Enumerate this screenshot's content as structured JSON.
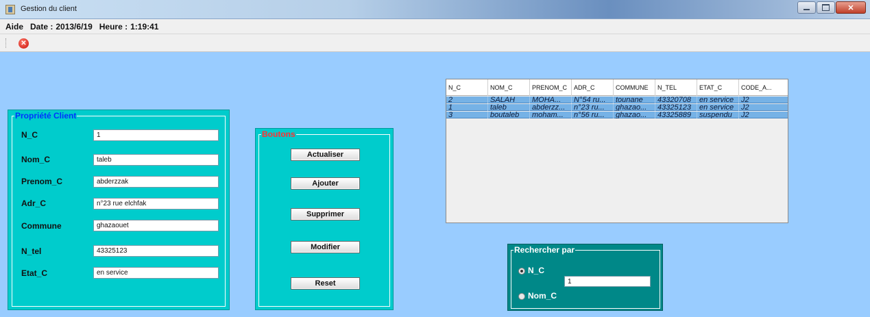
{
  "window": {
    "title": "Gestion du client",
    "icon": "app-icon"
  },
  "menu": {
    "help": "Aide",
    "date_label": "Date :",
    "date_value": "2013/6/19",
    "time_label": "Heure :",
    "time_value": "1:19:41"
  },
  "toolbar": {
    "close_icon": "close-circle-icon"
  },
  "client_form": {
    "legend": "Propriété Client",
    "fields": [
      {
        "label": "N_C",
        "value": "1"
      },
      {
        "label": "Nom_C",
        "value": "taleb"
      },
      {
        "label": "Prenom_C",
        "value": "abderzzak"
      },
      {
        "label": "Adr_C",
        "value": "n°23 rue elchfak"
      },
      {
        "label": "Commune",
        "value": "ghazaouet"
      },
      {
        "label": "N_tel",
        "value": "43325123"
      },
      {
        "label": "Etat_C",
        "value": "en service"
      }
    ]
  },
  "buttons_panel": {
    "legend": "Boutons",
    "buttons": [
      "Actualiser",
      "Ajouter",
      "Supprimer",
      "Modifier",
      "Reset"
    ]
  },
  "table": {
    "columns": [
      "N_C",
      "NOM_C",
      "PRENOM_C",
      "ADR_C",
      "COMMUNE",
      "N_TEL",
      "ETAT_C",
      "CODE_A..."
    ],
    "rows": [
      [
        "2",
        "SALAH",
        "MOHA...",
        "N°54 ru...",
        "tounane",
        "43320708",
        "en service",
        "J2"
      ],
      [
        "1",
        "taleb",
        "abderzz...",
        "n°23 ru...",
        "ghazao...",
        "43325123",
        "en service",
        "J2"
      ],
      [
        "3",
        "boutaleb",
        "moham...",
        "n°56 ru...",
        "ghazao...",
        "43325889",
        "suspendu",
        "J2"
      ]
    ]
  },
  "search": {
    "legend": "Rechercher par",
    "option_nc": "N_C",
    "option_nom": "Nom_C",
    "selected": "N_C",
    "input_value": "1"
  },
  "colors": {
    "background": "#99ccff",
    "panel": "#00cccc",
    "search_panel": "#008888",
    "legend_client": "#0033ff",
    "legend_buttons": "#ff3333",
    "table_row": "#76b2e6"
  }
}
